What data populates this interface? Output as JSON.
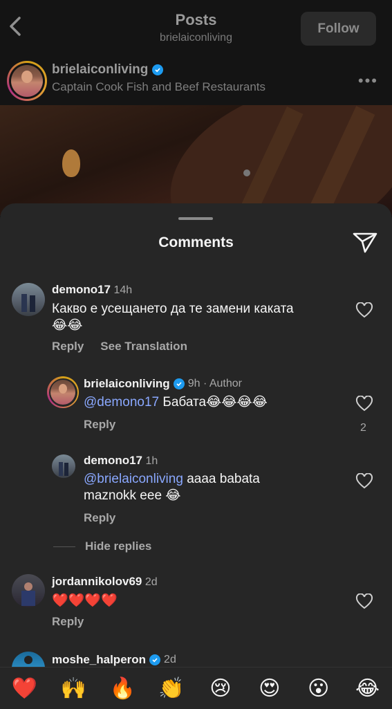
{
  "header": {
    "title": "Posts",
    "subtitle": "brielaiconliving",
    "follow_label": "Follow"
  },
  "post_author": {
    "name": "brielaiconliving",
    "location": "Captain Cook Fish and Beef Restaurants",
    "more_label": "•••"
  },
  "sheet": {
    "title": "Comments"
  },
  "comments": [
    {
      "username": "demono17",
      "time": "14h",
      "text": "Какво е усещането да те замени каката",
      "emoji": "😂😂",
      "reply_label": "Reply",
      "translate_label": "See Translation"
    },
    {
      "username": "brielaiconliving",
      "time": "9h · Author",
      "mention": "@demono17",
      "text": " Бабата😂😂😂😂",
      "reply_label": "Reply",
      "likes": "2"
    },
    {
      "username": "demono17",
      "time": "1h",
      "mention": "@brielaiconliving",
      "text": " aaaa babata maznokk eee 😂",
      "reply_label": "Reply"
    },
    {
      "username": "jordannikolov69",
      "time": "2d",
      "text": "❤️❤️❤️❤️",
      "reply_label": "Reply"
    },
    {
      "username": "moshe_halperon",
      "time": "2d"
    }
  ],
  "hide_replies_label": "Hide replies",
  "emoji_bar": [
    "❤️",
    "🙌",
    "🔥",
    "👏",
    "😢",
    "😍",
    "😮",
    "😂"
  ]
}
